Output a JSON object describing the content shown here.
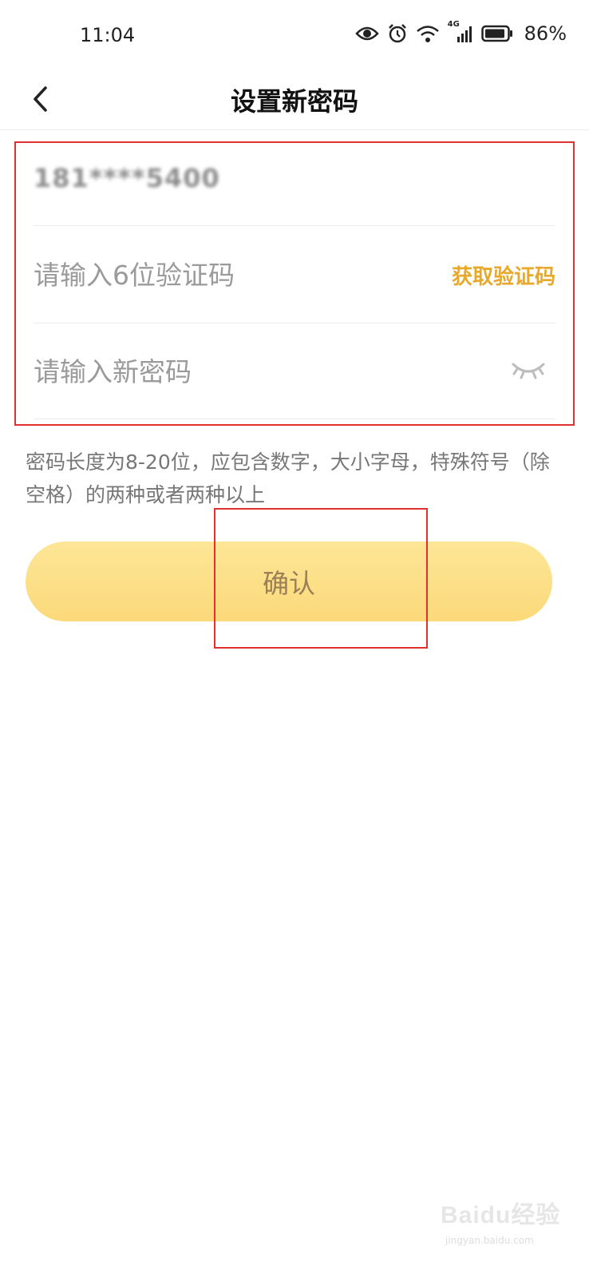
{
  "status_bar": {
    "time": "11:04",
    "network": "4G",
    "battery": "86%"
  },
  "header": {
    "title": "设置新密码"
  },
  "form": {
    "phone_value": "181****5400",
    "code_placeholder": "请输入6位验证码",
    "get_code_label": "获取验证码",
    "password_placeholder": "请输入新密码"
  },
  "hint": "密码长度为8-20位，应包含数字，大小字母，特殊符号（除空格）的两种或者两种以上",
  "confirm_label": "确认",
  "watermark": {
    "main": "Baidu经验",
    "sub": "jingyan.baidu.com"
  },
  "colors": {
    "accent": "#e8a92a",
    "button_bg": "#fcd97a",
    "button_text": "#9a8054",
    "annotation_red": "#e03030"
  }
}
